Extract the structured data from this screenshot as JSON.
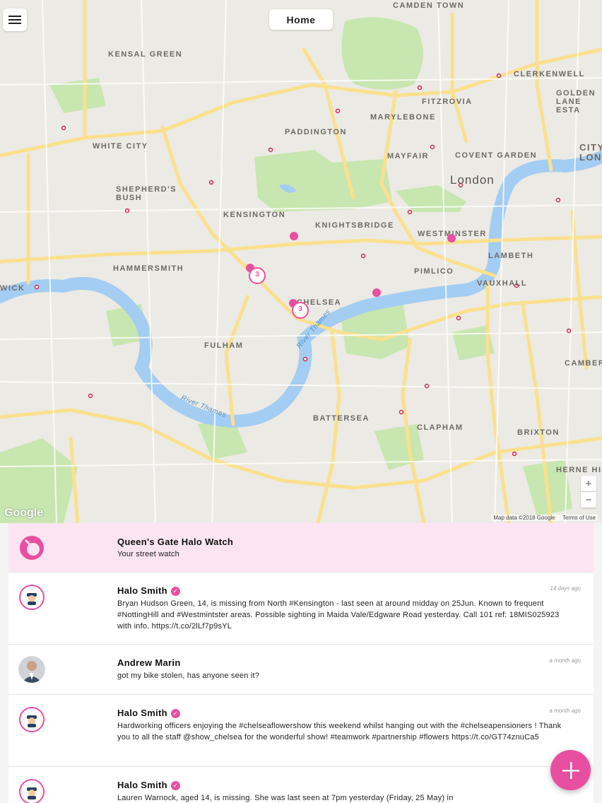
{
  "header": {
    "title": "Home"
  },
  "map": {
    "labels": {
      "kensal_green": "KENSAL GREEN",
      "white_city": "WHITE CITY",
      "shepherds_bush": "SHEPHERD'S BUSH",
      "kensington": "KENSINGTON",
      "knightsbridge": "KNIGHTSBRIDGE",
      "hammersmith": "HAMMERSMITH",
      "chelsea": "CHELSEA",
      "fulham": "FULHAM",
      "battersea": "BATTERSEA",
      "clapham": "CLAPHAM",
      "brixton": "BRIXTON",
      "herne_hill": "HERNE HILL",
      "pimlico": "PIMLICO",
      "vauxhall": "VAUXHALL",
      "lambeth": "LAMBETH",
      "westminster": "WESTMINSTER",
      "london": "London",
      "paddington": "PADDINGTON",
      "marylebone": "MARYLEBONE",
      "fitzrovia": "FITZROVIA",
      "mayfair": "MAYFAIR",
      "covent_garden": "COVENT GARDEN",
      "camden_town": "CAMDEN TOWN",
      "clerkenwell": "CLERKENWELL",
      "golden_lane": "GOLDEN LANE ESTA",
      "city": "CITY LONI",
      "camberwell": "CAMBERWI",
      "wick": "WICK",
      "river_thames": "River Thames",
      "river_thames_2": "River Thames"
    },
    "cluster_counts": [
      "3",
      "3"
    ],
    "google": "Google",
    "attribution": "Map data ©2018 Google",
    "terms": "Terms of Use",
    "zoom_in": "+",
    "zoom_out": "−",
    "colors": {
      "marker": "#e94fa0",
      "water": "#a3cdf2",
      "park": "#c8e6b0",
      "road": "#fbe08d"
    }
  },
  "feed": {
    "group": {
      "title": "Queen's Gate Halo Watch",
      "subtitle": "Your street watch"
    },
    "posts": [
      {
        "author": "Halo Smith",
        "verified": true,
        "time": "14 days ago",
        "text": "Bryan Hudson Green, 14, is missing from North #Kensington - last seen at around midday on 25Jun. Known to frequent #NottingHill and #Westmintster areas. Possible sighting in Maida Vale/Edgware Road yesterday. Call 101 ref: 18MIS025923 with info. https://t.co/2lLf7p9sYL"
      },
      {
        "author": "Andrew Marin",
        "verified": false,
        "time": "a month ago",
        "text": "got my bike stolen, has anyone seen it?"
      },
      {
        "author": "Halo Smith",
        "verified": true,
        "time": "a month ago",
        "text": "Hardworking officers enjoying the #chelseaflowershow this weekend whilst hanging out with the #chelseapensioners ! Thank you to all the staff @show_chelsea for the wonderful show! #teamwork #partnership #flowers https://t.co/GT74znuCa5"
      },
      {
        "author": "Halo Smith",
        "verified": true,
        "time": "a",
        "text": "Lauren Warnock, aged 14, is missing. She was last seen at 7pm yesterday (Friday, 25 May) in"
      }
    ],
    "verified_mark": "✓"
  },
  "fab": {
    "icon": "plus-icon"
  }
}
